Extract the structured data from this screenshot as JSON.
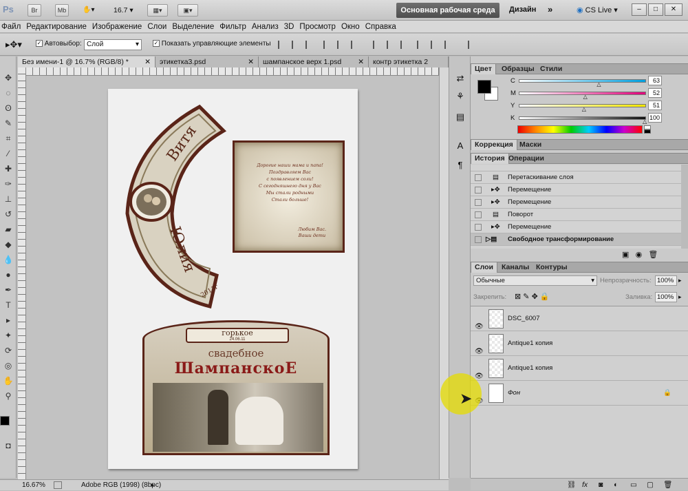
{
  "appbar": {
    "logo": "Ps",
    "bridge_btn": "Br",
    "minibridge_btn": "Mb",
    "zoom": "16.7",
    "workspace_active": "Основная рабочая среда",
    "workspace_other": "Дизайн",
    "more": "»",
    "cs_live": "CS Live"
  },
  "menu": [
    "Файл",
    "Редактирование",
    "Изображение",
    "Слои",
    "Выделение",
    "Фильтр",
    "Анализ",
    "3D",
    "Просмотр",
    "Окно",
    "Справка"
  ],
  "options": {
    "autoselect_label": "Автовыбор:",
    "autoselect_value": "Слой",
    "show_controls_label": "Показать управляющие элементы"
  },
  "doc_tabs": [
    {
      "label": "Без имени-1 @ 16.7% (RGB/8) *"
    },
    {
      "label": "этикетка3.psd"
    },
    {
      "label": "шампанское верх 1.psd"
    },
    {
      "label": "контр этикетка 2"
    }
  ],
  "artwork": {
    "collar_name1": "Витя",
    "collar_name2": "Юлия",
    "collar_year": "2011г",
    "note_lines": [
      "Дорогие наши мама и папа!",
      "Поздравляем Вас",
      "с появлением соли!",
      "С сегодняшнего дня у Вас",
      "Мы стали родными",
      "Стали больше!"
    ],
    "note_sign": [
      "Любим Вас.",
      "Ваши дети"
    ],
    "label_top": "горькое",
    "label_date": "24.06.11",
    "label_sub": "свадебное",
    "label_main": "ШампанскоЕ"
  },
  "status": {
    "zoom": "16.67%",
    "profile": "Adobe RGB (1998) (8bpc)"
  },
  "color_panel": {
    "tabs": [
      "Цвет",
      "Образцы",
      "Стили"
    ],
    "channels": [
      {
        "label": "C",
        "value": "63"
      },
      {
        "label": "M",
        "value": "52"
      },
      {
        "label": "Y",
        "value": "51"
      },
      {
        "label": "K",
        "value": "100"
      }
    ],
    "channel_levels": [
      0.63,
      0.52,
      0.51,
      1.0
    ]
  },
  "adjust_panel": {
    "tabs": [
      "Коррекция",
      "Маски"
    ]
  },
  "history_panel": {
    "tabs": [
      "История",
      "Операции"
    ],
    "items": [
      "Перетаскивание слоя",
      "Перемещение",
      "Перемещение",
      "Поворот",
      "Перемещение",
      "Свободное трансформирование"
    ]
  },
  "layers_panel": {
    "tabs": [
      "Слои",
      "Каналы",
      "Контуры"
    ],
    "blend_mode": "Обычные",
    "opacity_label": "Непрозрачность:",
    "opacity_value": "100%",
    "lock_label": "Закрепить:",
    "fill_label": "Заливка:",
    "fill_value": "100%",
    "layers": [
      {
        "name": "DSC_6007"
      },
      {
        "name": "Antique1 копия"
      },
      {
        "name": "Antique1 копия"
      },
      {
        "name": "Фон"
      }
    ]
  }
}
